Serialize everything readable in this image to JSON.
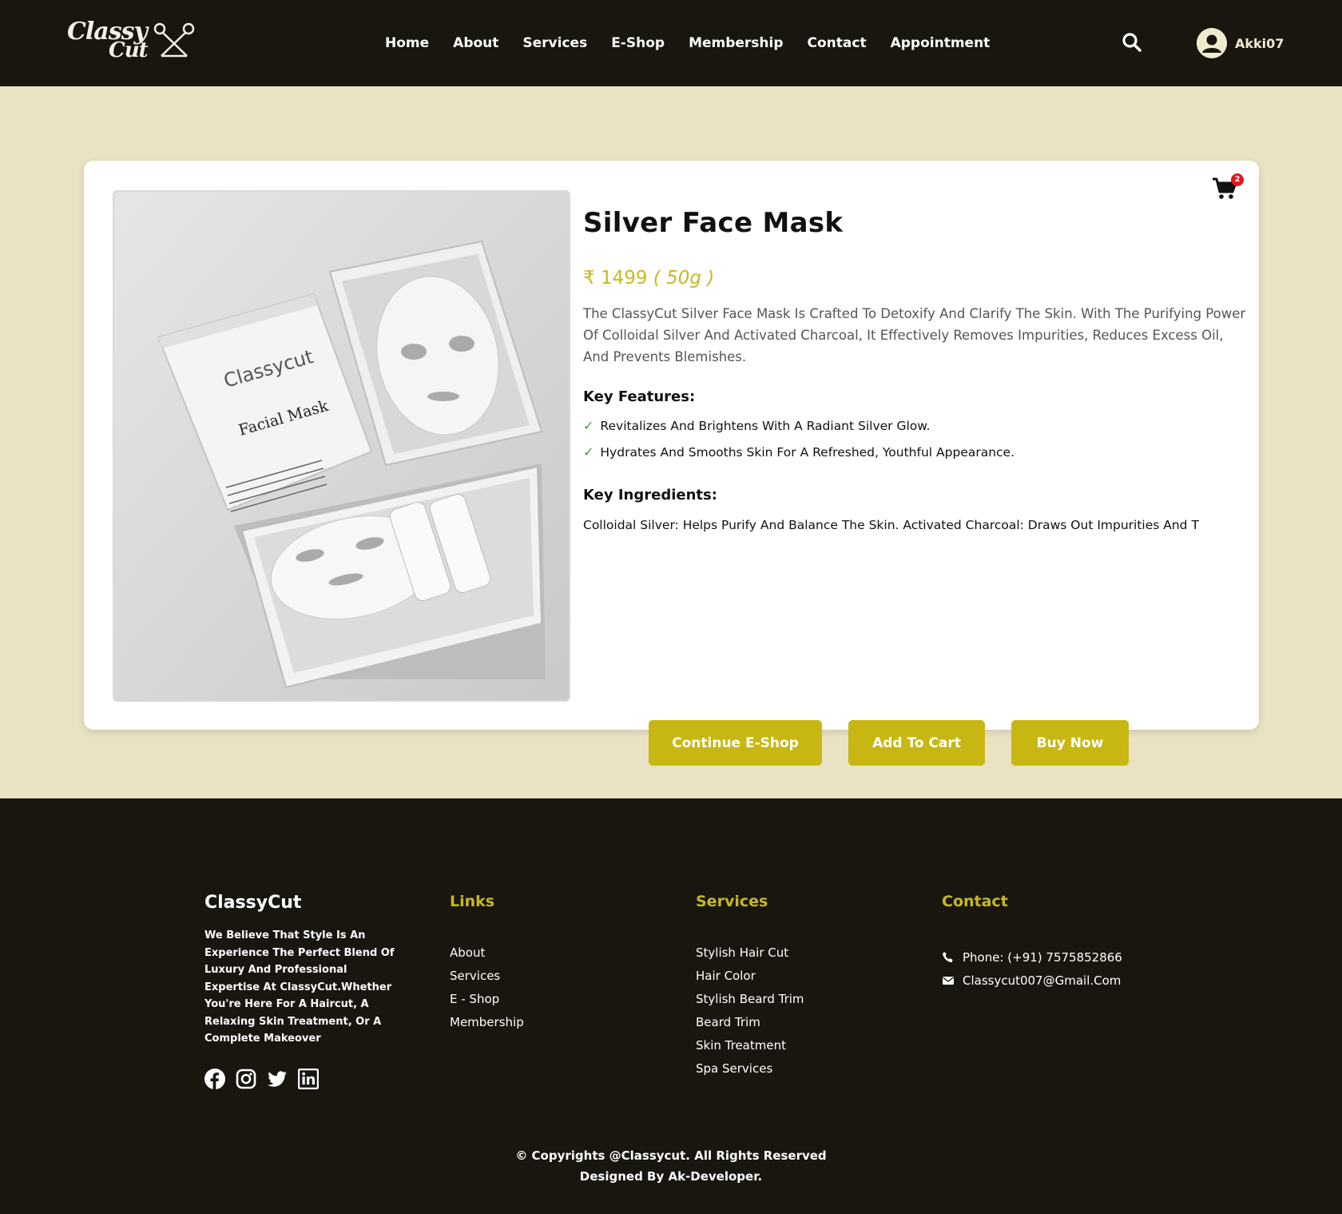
{
  "header": {
    "logo_line1": "Classy",
    "logo_line2": "Cut",
    "nav": [
      "Home",
      "About",
      "Services",
      "E-Shop",
      "Membership",
      "Contact",
      "Appointment"
    ],
    "username": "Akki07"
  },
  "cart": {
    "count": "2"
  },
  "product": {
    "title": "Silver Face Mask",
    "price": "₹ 1499",
    "quantity": "( 50g )",
    "description": "The ClassyCut Silver Face Mask Is Crafted To Detoxify And Clarify The Skin. With The Purifying Power Of Colloidal Silver And Activated Charcoal, It Effectively Removes Impurities, Reduces Excess Oil, And Prevents Blemishes.",
    "key_features_title": "Key Features:",
    "features": [
      "Revitalizes And Brightens With A Radiant Silver Glow.",
      "Hydrates And Smooths Skin For A Refreshed, Youthful Appearance."
    ],
    "key_ingredients_title": "Key Ingredients:",
    "ingredients": "Colloidal Silver: Helps Purify And Balance The Skin. Activated Charcoal: Draws Out Impurities And T",
    "box_brand": "Classycut",
    "box_label": "Facial Mask",
    "buttons": {
      "continue": "Continue E-Shop",
      "add_to_cart": "Add To Cart",
      "buy_now": "Buy Now"
    }
  },
  "footer": {
    "brand": "ClassyCut",
    "about": "We Believe That Style Is An Experience The Perfect Blend Of Luxury And Professional Expertise At ClassyCut.Whether You're Here For A Haircut, A Relaxing Skin Treatment, Or A Complete Makeover",
    "links_title": "Links",
    "links": [
      "About",
      "Services",
      "E - Shop",
      "Membership"
    ],
    "services_title": "Services",
    "services": [
      "Stylish Hair Cut",
      "Hair Color",
      "Stylish Beard Trim",
      "Beard Trim",
      "Skin Treatment",
      "Spa Services"
    ],
    "contact_title": "Contact",
    "phone": "Phone: (+91) 7575852866",
    "email": "Classycut007@Gmail.Com",
    "copyright": "© Copyrights @Classycut. All Rights Reserved",
    "designed_by": "Designed By Ak-Developer."
  },
  "colors": {
    "header_bg": "#19160f",
    "page_bg": "#e9e3c3",
    "accent": "#c8b712",
    "cart_badge": "#e4141b"
  }
}
